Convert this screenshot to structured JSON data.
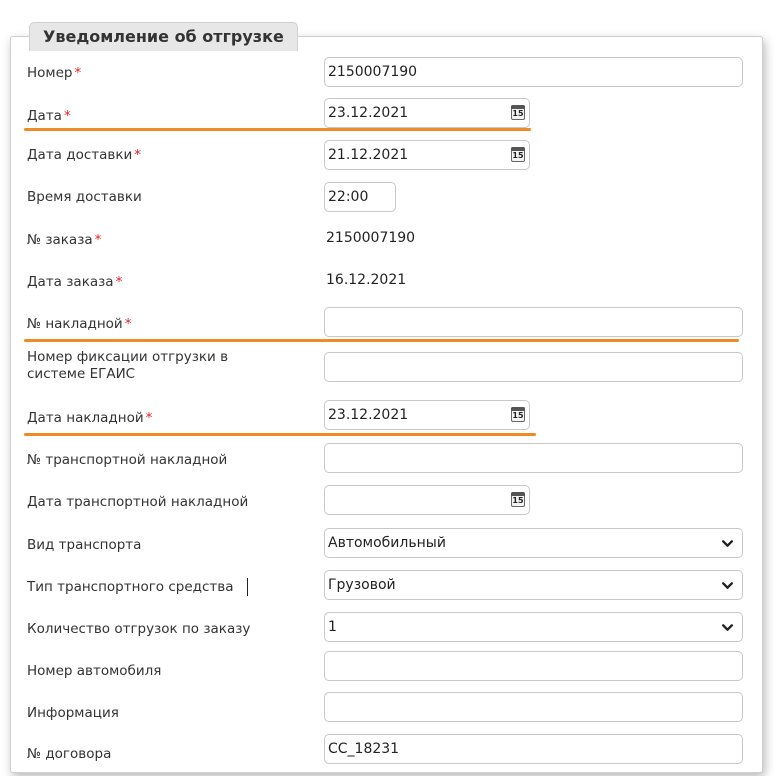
{
  "form": {
    "title": "Уведомление об отгрузке",
    "required_mark": "*",
    "number": {
      "label": "Номер",
      "value": "2150007190"
    },
    "date": {
      "label": "Дата",
      "value": "23.12.2021"
    },
    "delivery_date": {
      "label": "Дата доставки",
      "value": "21.12.2021"
    },
    "delivery_time": {
      "label": "Время доставки",
      "value": "22:00"
    },
    "order_number": {
      "label": "№ заказа",
      "value": "2150007190"
    },
    "order_date": {
      "label": "Дата заказа",
      "value": "16.12.2021"
    },
    "invoice_number": {
      "label": "№ накладной",
      "value": ""
    },
    "egais_number": {
      "label_line1": "Номер фиксации отгрузки в",
      "label_line2": "системе ЕГАИС",
      "value": ""
    },
    "invoice_date": {
      "label": "Дата накладной",
      "value": "23.12.2021"
    },
    "transport_invoice_number": {
      "label": "№ транспортной накладной",
      "value": ""
    },
    "transport_invoice_date": {
      "label": "Дата транспортной накладной",
      "value": ""
    },
    "transport_type": {
      "label": "Вид транспорта",
      "value": "Автомобильный"
    },
    "vehicle_type": {
      "label": "Тип транспортного средства",
      "value": "Грузовой"
    },
    "shipments_count": {
      "label": "Количество отгрузок по заказу",
      "value": "1"
    },
    "car_number": {
      "label": "Номер автомобиля",
      "value": ""
    },
    "information": {
      "label": "Информация",
      "value": ""
    },
    "contract_number": {
      "label": "№ договора",
      "value": "CC_18231"
    }
  },
  "calendar_icon_day": "15",
  "colors": {
    "accent_underline": "#f08a24",
    "required": "#e02020"
  },
  "icons": {
    "calendar": "calendar-icon",
    "dropdown": "chevron-down-icon"
  }
}
